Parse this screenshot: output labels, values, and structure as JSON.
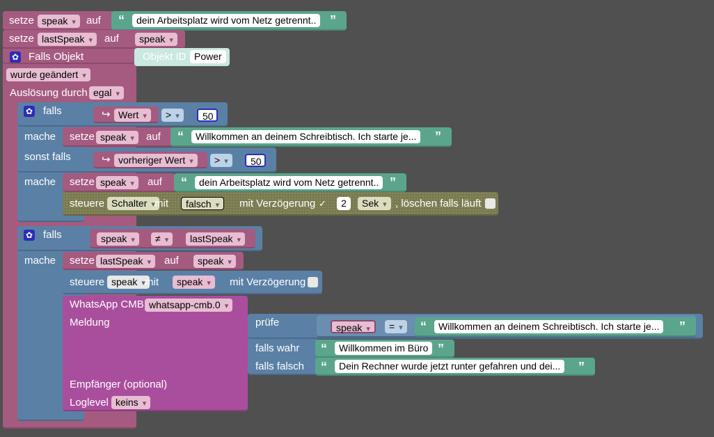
{
  "blocks": {
    "b1": {
      "kw_set": "setze",
      "var": "speak",
      "kw_on": "auf",
      "text": "dein Arbeitsplatz wird vom Netz getrennt.."
    },
    "b2": {
      "kw_set": "setze",
      "var": "lastSpeak",
      "kw_on": "auf",
      "value_var": "speak"
    },
    "trigger": {
      "title": "Falls Objekt",
      "object_label": "Objekt ID",
      "object_value": "Power",
      "changed": "wurde geändert",
      "trigger_label": "Auslösung durch",
      "trigger_value": "egal"
    },
    "if1": {
      "kw_if": "falls",
      "getter": "Wert",
      "op": ">",
      "num": "50",
      "kw_do": "mache",
      "set_kw": "setze",
      "set_var": "speak",
      "set_on": "auf",
      "set_text": "Willkommen an deinem Schreibtisch. Ich starte je...",
      "kw_elseif": "sonst falls",
      "getter2": "vorheriger Wert",
      "op2": ">",
      "num2": "50",
      "kw_do2": "mache",
      "set2_kw": "setze",
      "set2_var": "speak",
      "set2_on": "auf",
      "set2_text": "dein Arbeitsplatz wird vom Netz getrennt..",
      "ctrl_kw": "steuere",
      "ctrl_obj": "Schalter",
      "ctrl_with": "mit",
      "ctrl_val": "falsch",
      "ctrl_delay": "mit Verzögerung",
      "ctrl_delay_checked": "✓",
      "ctrl_delay_num": "2",
      "ctrl_unit": "Sek",
      "ctrl_clear": ", löschen falls läuft"
    },
    "if2": {
      "kw_if": "falls",
      "left": "speak",
      "op": "≠",
      "right": "lastSpeak",
      "kw_do": "mache",
      "set_kw": "setze",
      "set_var": "lastSpeak",
      "set_on": "auf",
      "set_val": "speak",
      "ctrl_kw": "steuere",
      "ctrl_obj": "speak",
      "ctrl_with": "mit",
      "ctrl_val": "speak",
      "ctrl_delay": "mit Verzögerung"
    },
    "wa": {
      "title": "WhatsApp CMB",
      "instance": "whatsapp-cmb.0",
      "msg_label": "Meldung",
      "recipient": "Empfänger (optional)",
      "loglevel_label": "Loglevel",
      "loglevel": "keins",
      "ternary": {
        "check": "prüfe",
        "left": "speak",
        "op": "=",
        "right_text": "Willkommen an deinem Schreibtisch. Ich starte je...",
        "if_true": "falls wahr",
        "true_text": "Willkommen im Büro",
        "if_false": "falls falsch",
        "false_text": "Dein Rechner wurde jetzt runter gefahren und dei..."
      }
    }
  },
  "colors": {
    "pink": "#a55b80",
    "blue": "#5b80a5",
    "green": "#5ba58c",
    "olive": "#7a7a52",
    "workspace": "#505050"
  },
  "icons": {
    "gear": "gear-icon",
    "quote": "quote-icon",
    "arrow": "arrow-getter-icon"
  }
}
